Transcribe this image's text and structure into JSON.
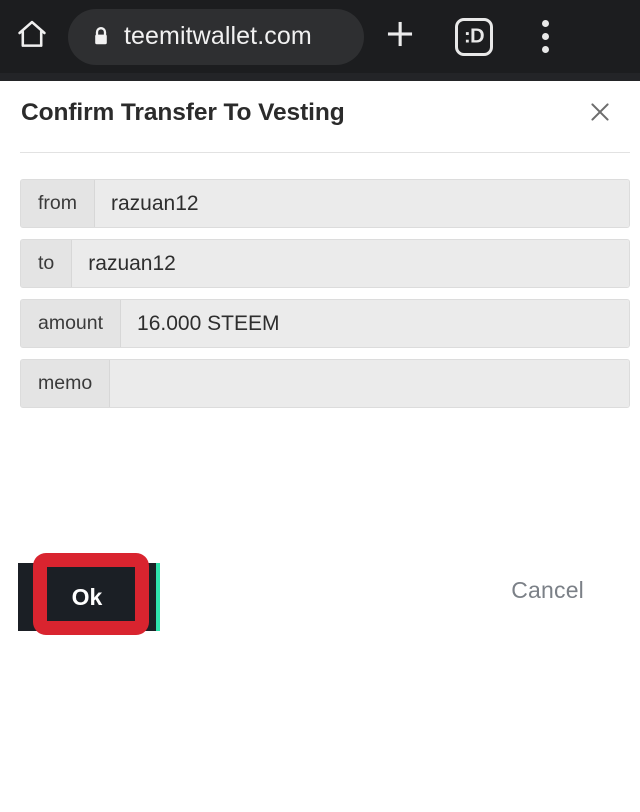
{
  "browser": {
    "home_icon": "home-icon",
    "lock_icon": "lock-icon",
    "url": "teemitwallet.com",
    "new_tab_icon": "plus-icon",
    "tab_switcher_label": ":D",
    "menu_icon": "kebab-menu-icon"
  },
  "dialog": {
    "title": "Confirm Transfer To Vesting",
    "close_icon": "close-icon",
    "fields": [
      {
        "label": "from",
        "value": "razuan12"
      },
      {
        "label": "to",
        "value": "razuan12"
      },
      {
        "label": "amount",
        "value": "16.000 STEEM"
      },
      {
        "label": "memo",
        "value": ""
      }
    ],
    "ok_label": "Ok",
    "cancel_label": "Cancel"
  },
  "colors": {
    "toolbar_bg": "#1c1d1f",
    "url_pill_bg": "#2e2f31",
    "ok_button_bg": "#1b1f25",
    "ok_accent": "#2fe3ad",
    "highlight_red": "#d9242f",
    "field_bg": "#ebebeb",
    "field_label_bg": "#e4e4e4"
  }
}
